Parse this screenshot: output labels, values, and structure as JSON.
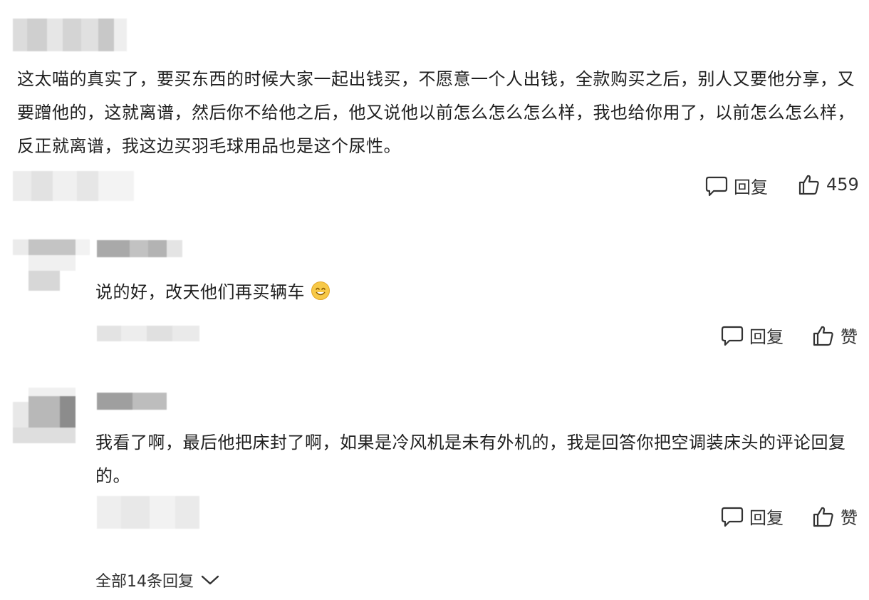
{
  "comments": [
    {
      "text": "这太喵的真实了，要买东西的时候大家一起出钱买，不愿意一个人出钱，全款购买之后，别人又要他分享，又要蹭他的，这就离谱，然后你不给他之后，他又说他以前怎么怎么怎么样，我也给你用了，以前怎么怎么样，反正就离谱，我这边买羽毛球用品也是这个尿性。",
      "reply_label": "回复",
      "like_label": "459"
    },
    {
      "text": "说的好，改天他们再买辆车",
      "emoji": "smiley-emoji",
      "reply_label": "回复",
      "like_label": "赞"
    },
    {
      "text": "我看了啊，最后他把床封了啊，如果是冷风机是未有外机的，我是回答你把空调装床头的评论回复的。",
      "reply_label": "回复",
      "like_label": "赞"
    }
  ],
  "expand_replies": {
    "label": "全部14条回复",
    "icon": "chevron-down-icon"
  },
  "icons": {
    "reply": "comment-bubble-icon",
    "like": "thumbs-up-icon"
  },
  "colors": {
    "text": "#1f1f1f",
    "icon": "#333333",
    "redaction": "#c9c9c9"
  }
}
